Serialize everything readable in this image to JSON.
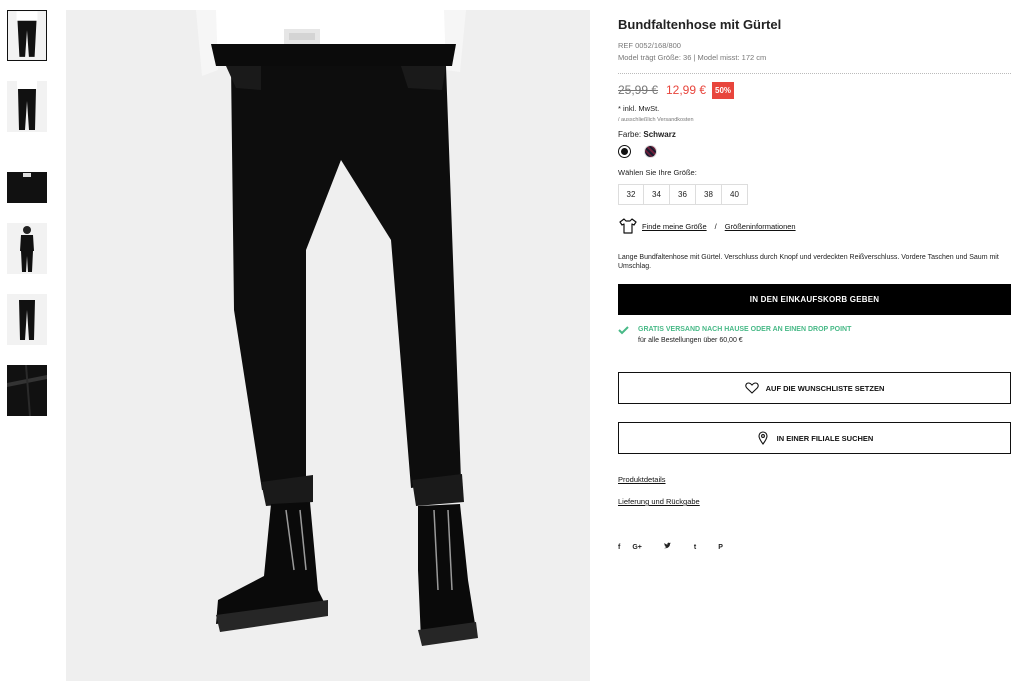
{
  "product": {
    "title": "Bundfaltenhose mit Gürtel",
    "ref": "REF 0052/168/800",
    "model": "Model trägt Größe: 36 | Model misst: 172 cm",
    "old_price": "25,99 €",
    "new_price": "12,99 €",
    "discount": "50%",
    "tax_note": "* inkl. MwSt.",
    "shipping_note": "/ ausschließlich Versandkosten",
    "color_label": "Farbe:",
    "color_value": "Schwarz",
    "size_label": "Wählen Sie Ihre Größe:",
    "sizes": [
      "32",
      "34",
      "36",
      "38",
      "40"
    ],
    "size_guide": "Finde meine Größe",
    "size_separator": "/",
    "size_info": "Größeninformationen",
    "description": "Lange Bundfaltenhose mit Gürtel. Verschluss durch Knopf und verdeckten Reißverschluss. Vordere Taschen und Saum mit Umschlag.",
    "cart_button": "IN DEN EINKAUFSKORB GEBEN",
    "free_shipping": "GRATIS VERSAND NACH HAUSE ODER AN EINEN DROP POINT",
    "free_shipping_min": "für alle Bestellungen über 60,00 €",
    "wishlist_button": "AUF DIE WUNSCHLISTE SETZEN",
    "store_button": "IN EINER FILIALE SUCHEN",
    "details_link": "Produktdetails",
    "delivery_link": "Lieferung und Rückgabe"
  },
  "social": [
    "f",
    "G+",
    "t",
    "P"
  ],
  "colors": {
    "accent": "#e8453c",
    "success": "#48b987",
    "primary": "#000000"
  },
  "icons": {
    "size_guide": "t-shirt-icon",
    "wishlist": "heart-icon",
    "store": "location-pin-icon",
    "shipping": "check-icon"
  }
}
